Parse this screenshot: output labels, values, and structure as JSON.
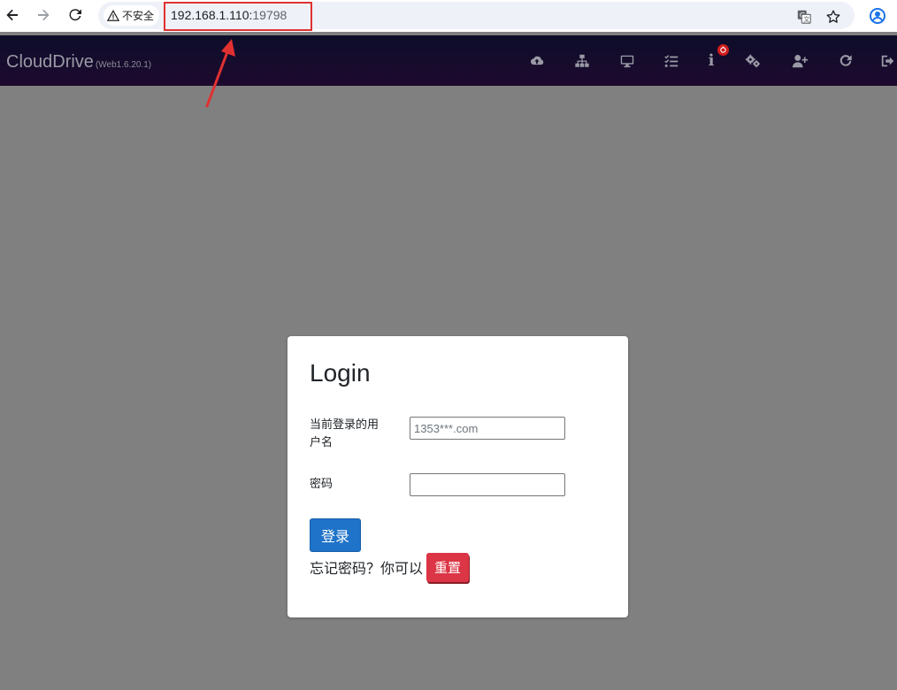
{
  "browser": {
    "security_label": "不安全",
    "url_host": "192.168.1.110:",
    "url_port": "19798"
  },
  "app": {
    "brand": "CloudDrive",
    "version": "(Web1.6.20.1)",
    "nav_icons": [
      "cloud-upload-icon",
      "network-icon",
      "desktop-icon",
      "task-list-icon",
      "info-icon",
      "settings-icon",
      "add-user-icon",
      "refresh-icon",
      "logout-icon"
    ]
  },
  "login": {
    "title": "Login",
    "username_label": "当前登录的用户名",
    "username_placeholder": "1353***.com",
    "password_label": "密码",
    "submit_label": "登录",
    "forgot_text": "忘记密码？你可以",
    "reset_label": "重置"
  },
  "colors": {
    "navbar": "#140c2a",
    "background": "#808080",
    "primary": "#1f73c9",
    "danger": "#dc3545",
    "annotation": "#e03131"
  }
}
